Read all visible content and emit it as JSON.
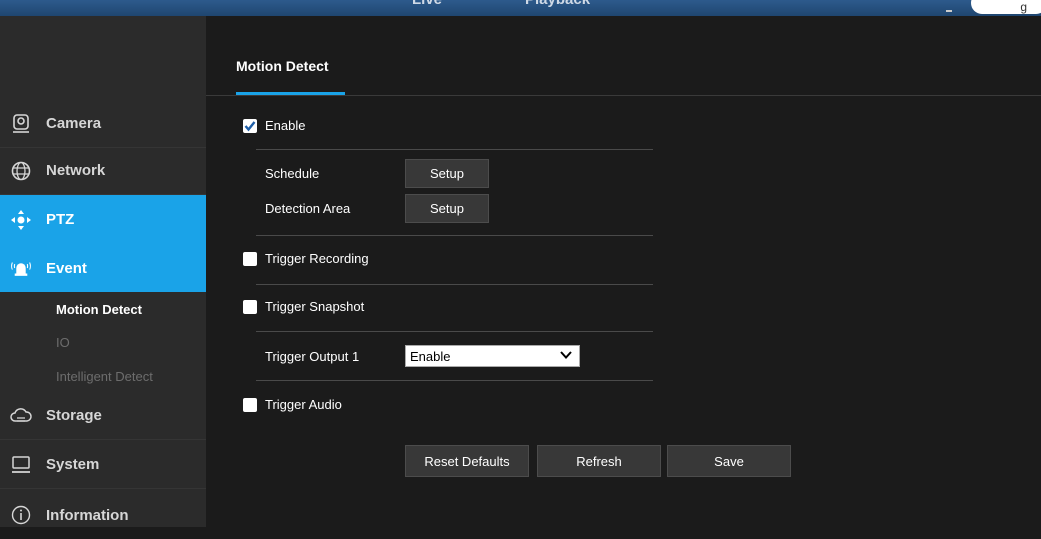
{
  "topbar": {
    "nav_live": "Live",
    "nav_playback": "Playback",
    "lang": "g"
  },
  "sidebar": {
    "items": [
      {
        "label": "Camera",
        "icon": "camera-icon"
      },
      {
        "label": "Network",
        "icon": "globe-icon"
      },
      {
        "label": "PTZ",
        "icon": "ptz-icon",
        "active": true
      },
      {
        "label": "Event",
        "icon": "alarm-icon",
        "active": true
      },
      {
        "label": "Storage",
        "icon": "cloud-icon"
      },
      {
        "label": "System",
        "icon": "monitor-icon"
      },
      {
        "label": "Information",
        "icon": "info-icon"
      }
    ],
    "sub_items": [
      {
        "label": "Motion Detect",
        "current": true
      },
      {
        "label": "IO"
      },
      {
        "label": "Intelligent Detect"
      }
    ]
  },
  "main": {
    "tab_title": "Motion Detect",
    "enable": {
      "label": "Enable",
      "checked": true
    },
    "schedule_label": "Schedule",
    "schedule_button": "Setup",
    "detection_area_label": "Detection Area",
    "detection_area_button": "Setup",
    "trigger_recording": {
      "label": "Trigger Recording",
      "checked": false
    },
    "trigger_snapshot": {
      "label": "Trigger Snapshot",
      "checked": false
    },
    "trigger_output_label": "Trigger Output 1",
    "trigger_output_value": "Enable",
    "trigger_audio": {
      "label": "Trigger Audio",
      "checked": false
    },
    "buttons": {
      "reset": "Reset Defaults",
      "refresh": "Refresh",
      "save": "Save"
    }
  },
  "colors": {
    "accent": "#1aa3e8",
    "sidebar_bg": "#2b2b2b",
    "main_bg": "#1b1b1b"
  }
}
